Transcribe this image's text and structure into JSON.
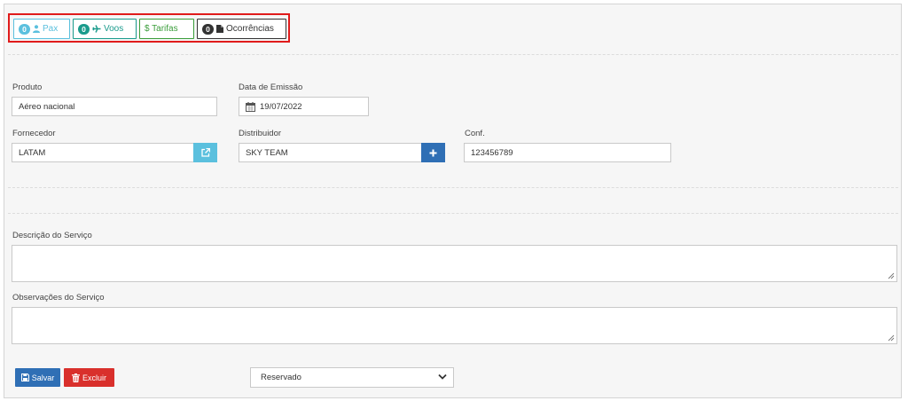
{
  "tabs": [
    {
      "badge": "0",
      "label": "Pax",
      "color": "#5bc0de",
      "icon": "user-icon"
    },
    {
      "badge": "0",
      "label": "Voos",
      "color": "#1a9b8c",
      "icon": "plane-icon"
    },
    {
      "badge": "",
      "label": "$ Tarifas",
      "color": "#3a9d3a",
      "icon": "dollar-icon"
    },
    {
      "badge": "0",
      "label": "Ocorrências",
      "color": "#333333",
      "icon": "file-icon"
    }
  ],
  "form": {
    "produto_label": "Produto",
    "produto_value": "Aéreo nacional",
    "data_emissao_label": "Data de Emissão",
    "data_emissao_value": "19/07/2022",
    "fornecedor_label": "Fornecedor",
    "fornecedor_value": "LATAM",
    "distribuidor_label": "Distribuidor",
    "distribuidor_value": "SKY TEAM",
    "conf_label": "Conf.",
    "conf_value": "123456789",
    "descricao_label": "Descrição do Serviço",
    "observacoes_label": "Observações do Serviço"
  },
  "actions": {
    "salvar_label": "Salvar",
    "excluir_label": "Excluir",
    "status_selected": "Reservado"
  },
  "colors": {
    "primary": "#2f6fb5",
    "info": "#5bc0de",
    "danger": "#d9302c",
    "highlight_border": "#e01b1b"
  }
}
